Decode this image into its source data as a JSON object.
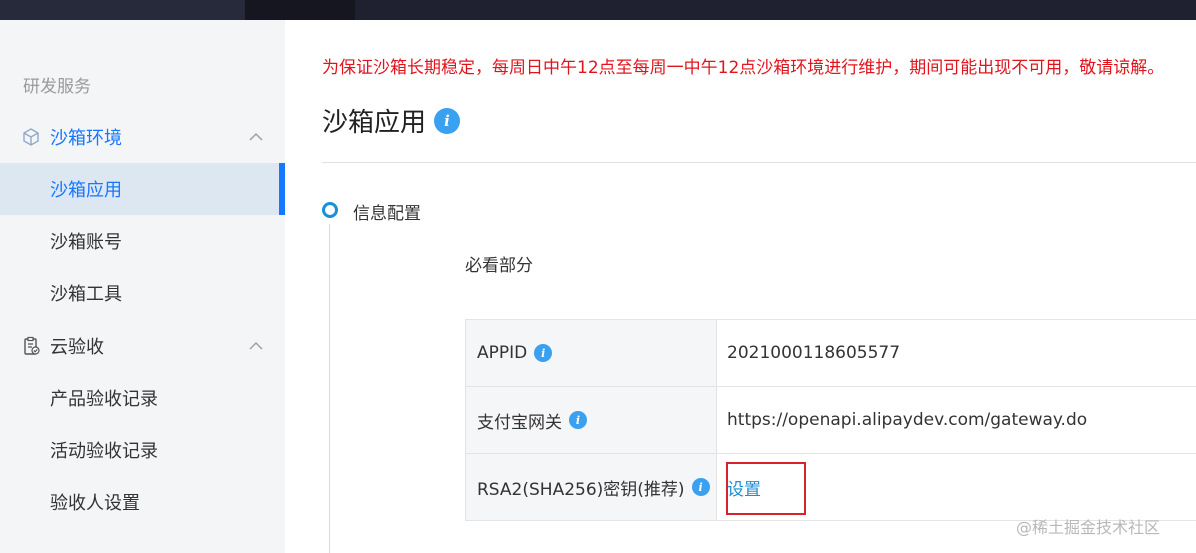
{
  "sidebar": {
    "section_title": "研发服务",
    "groups": [
      {
        "label": "沙箱环境",
        "icon": "cube-icon",
        "items": [
          "沙箱应用",
          "沙箱账号",
          "沙箱工具"
        ]
      },
      {
        "label": "云验收",
        "icon": "clipboard-check-icon",
        "items": [
          "产品验收记录",
          "活动验收记录",
          "验收人设置"
        ]
      }
    ],
    "active_item": "沙箱应用",
    "accent_color": "#1677ff"
  },
  "main": {
    "notice": "为保证沙箱长期稳定，每周日中午12点至每周一中午12点沙箱环境进行维护，期间可能出现不可用，敬请谅解。",
    "page_title": "沙箱应用",
    "step_label": "信息配置",
    "subsection": "必看部分",
    "config_rows": [
      {
        "key": "APPID",
        "value": "2021000118605577"
      },
      {
        "key": "支付宝网关",
        "value": "https://openapi.alipaydev.com/gateway.do"
      },
      {
        "key": "RSA2(SHA256)密钥(推荐)",
        "value": "设置"
      }
    ],
    "notice_color": "#e1141d",
    "link_color": "#1b8fd8"
  },
  "watermark": "@稀土掘金技术社区"
}
